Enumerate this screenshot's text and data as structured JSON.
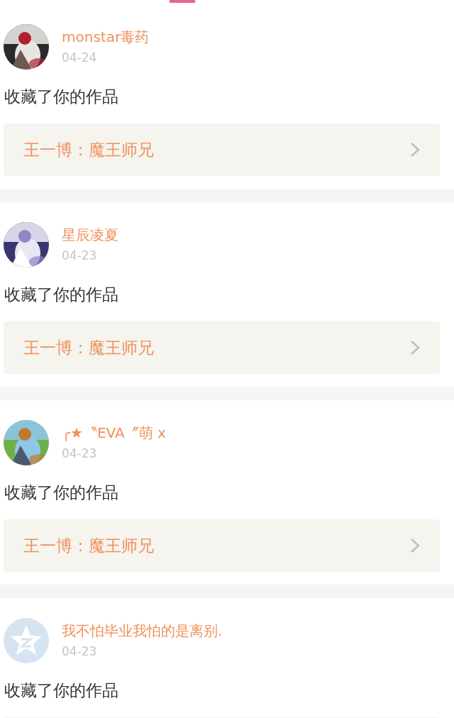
{
  "tab_indicator": {
    "selected": true
  },
  "notifications": [
    {
      "user": "monstar毒药",
      "date": "04-24",
      "action": "收藏了你的作品",
      "work": "王一博：魔王师兄"
    },
    {
      "user": "星辰凌夏",
      "date": "04-23",
      "action": "收藏了你的作品",
      "work": "王一博：魔王师兄"
    },
    {
      "user": "╭★〝EVA〞萌 x",
      "date": "04-23",
      "action": "收藏了你的作品",
      "work": "王一博：魔王师兄"
    },
    {
      "user": "我不怕毕业我怕的是离别.",
      "date": "04-23",
      "avatar": {
        "kind": "default"
      },
      "action": "收藏了你的作品"
    }
  ]
}
